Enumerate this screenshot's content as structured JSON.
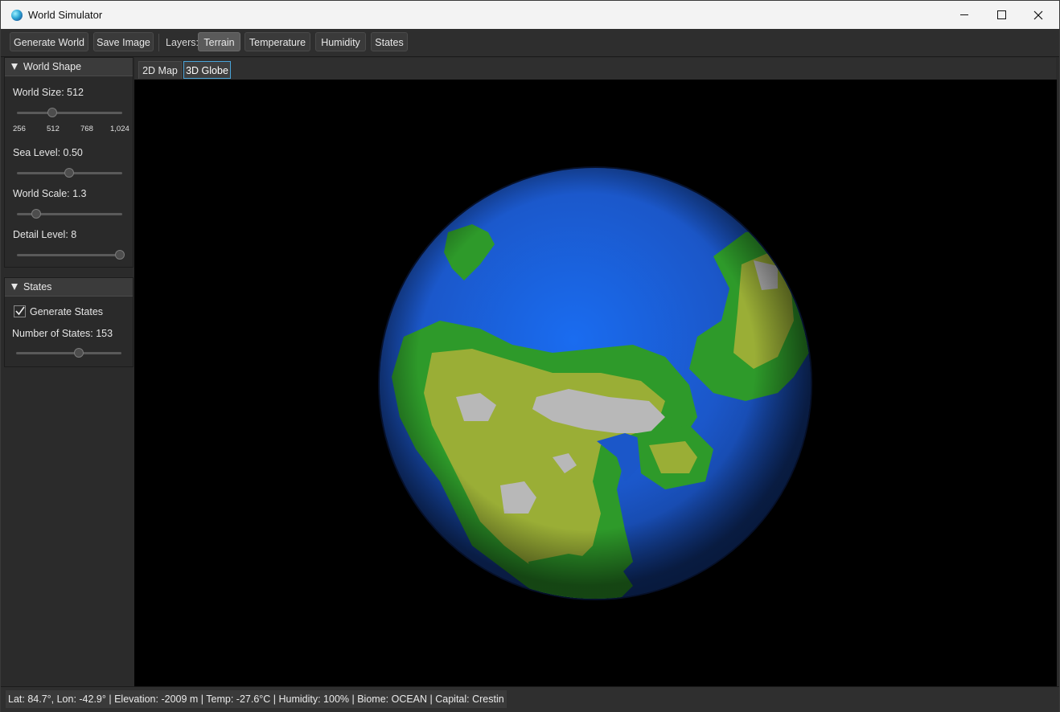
{
  "window": {
    "title": "World Simulator",
    "icon": "globe-app-icon"
  },
  "toolbar": {
    "generate_label": "Generate World",
    "save_label": "Save Image",
    "layers_label": "Layers:",
    "layers": [
      {
        "label": "Terrain",
        "selected": true
      },
      {
        "label": "Temperature",
        "selected": false
      },
      {
        "label": "Humidity",
        "selected": false
      },
      {
        "label": "States",
        "selected": false
      }
    ]
  },
  "sidebar": {
    "world_shape": {
      "title": "World Shape",
      "expanded": true,
      "world_size": {
        "label": "World Size: 512",
        "value": 512,
        "min": 256,
        "max": 1024,
        "ticks": [
          "256",
          "512",
          "768",
          "1,024"
        ]
      },
      "sea_level": {
        "label": "Sea Level: 0.50",
        "value": 0.5
      },
      "world_scale": {
        "label": "World Scale: 1.3",
        "value": 1.3
      },
      "detail_level": {
        "label": "Detail Level: 8",
        "value": 8
      }
    },
    "states": {
      "title": "States",
      "expanded": true,
      "generate_states": {
        "label": "Generate States",
        "checked": true
      },
      "number_of_states": {
        "label": "Number of States: 153",
        "value": 153
      }
    }
  },
  "view_tabs": [
    {
      "label": "2D Map",
      "active": false
    },
    {
      "label": "3D Globe",
      "active": true
    }
  ],
  "status": {
    "text": "Lat: 84.7°, Lon: -42.9° | Elevation: -2009 m | Temp: -27.6°C | Humidity: 100% | Biome: OCEAN | Capital: Crestin"
  },
  "colors": {
    "ocean": "#1f5fd6",
    "lowland": "#2e9a2a",
    "highland": "#9aae36",
    "mountain": "#b8b8b8",
    "accent": "#49a3d8"
  }
}
